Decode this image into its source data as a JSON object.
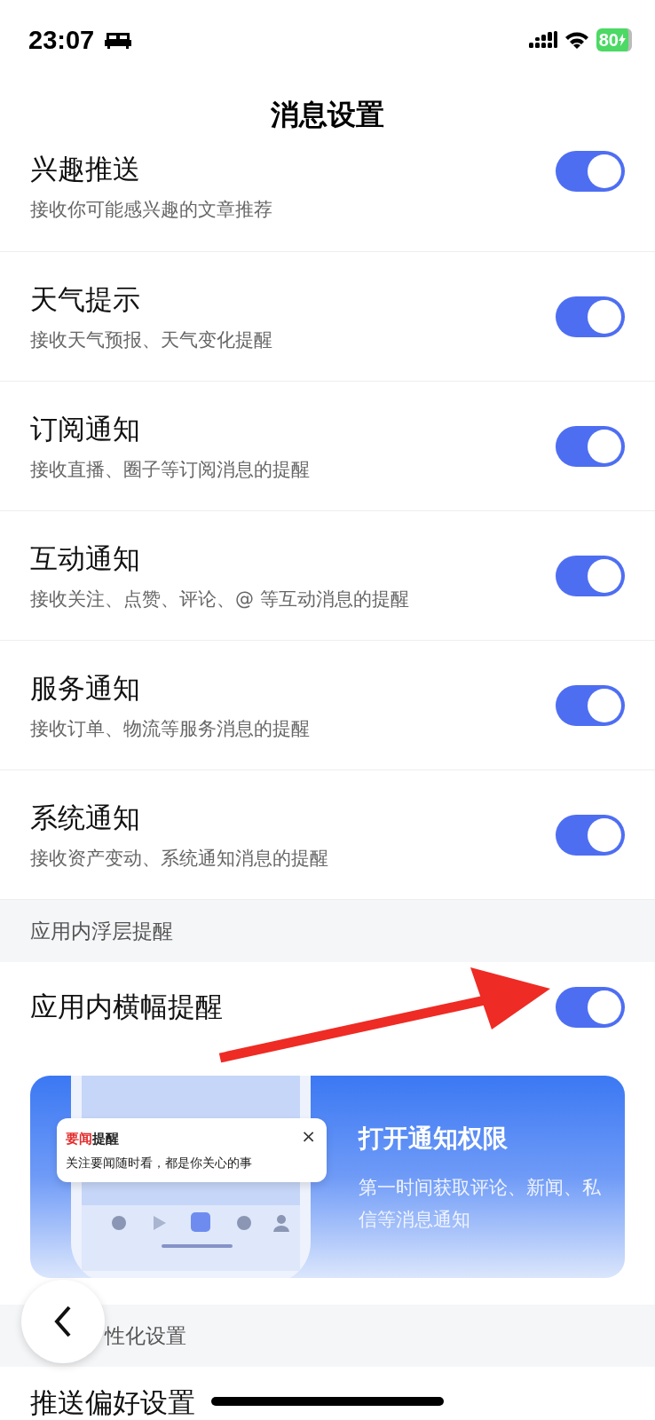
{
  "status_bar": {
    "time": "23:07",
    "battery": "80"
  },
  "nav": {
    "title": "消息设置"
  },
  "settings": [
    {
      "title": "兴趣推送",
      "subtitle": "接收你可能感兴趣的文章推荐",
      "on": true
    },
    {
      "title": "天气提示",
      "subtitle": "接收天气预报、天气变化提醒",
      "on": true
    },
    {
      "title": "订阅通知",
      "subtitle": "接收直播、圈子等订阅消息的提醒",
      "on": true
    },
    {
      "title": "互动通知",
      "subtitle": "接收关注、点赞、评论、@ 等互动消息的提醒",
      "on": true
    },
    {
      "title": "服务通知",
      "subtitle": "接收订单、物流等服务消息的提醒",
      "on": true
    },
    {
      "title": "系统通知",
      "subtitle": "接收资产变动、系统通知消息的提醒",
      "on": true
    }
  ],
  "section_1": {
    "title": "应用内浮层提醒",
    "items": [
      {
        "title": "应用内横幅提醒",
        "on": true
      }
    ]
  },
  "banner": {
    "notification": {
      "title": "**要闻**提醒",
      "body": "关注要闻随时看，都是你关心的事",
      "close": "×"
    },
    "title": "打开通知权限",
    "text": "第一时间获取评论、新闻、私信等消息通知"
  },
  "section_2": {
    "title": "性化设置",
    "items": [
      {
        "title": "推送偏好设置"
      }
    ]
  }
}
